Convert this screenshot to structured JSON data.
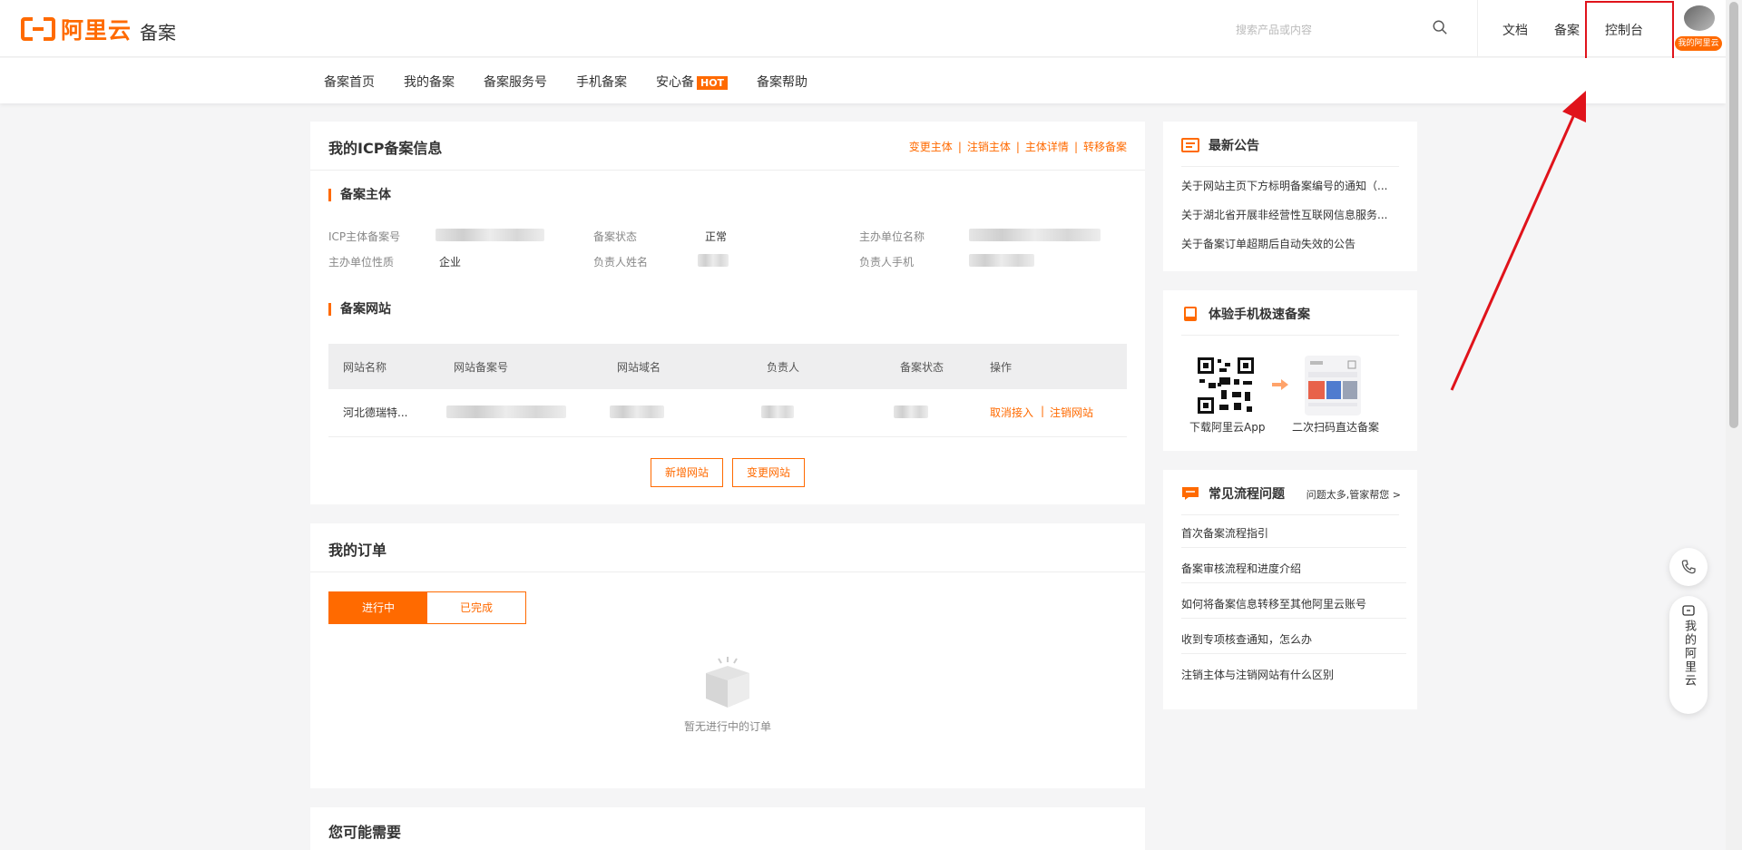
{
  "header": {
    "logo_text": "阿里云",
    "brand_sub": "备案",
    "search_placeholder": "搜索产品或内容",
    "links": [
      "文档",
      "备案",
      "控制台"
    ],
    "avatar_badge": "我的阿里云"
  },
  "subnav": {
    "items": [
      "备案首页",
      "我的备案",
      "备案服务号",
      "手机备案",
      "安心备",
      "备案帮助"
    ],
    "hot_badge": "HOT"
  },
  "icp_card": {
    "title": "我的ICP备案信息",
    "links": [
      "变更主体",
      "注销主体",
      "主体详情",
      "转移备案"
    ],
    "subject_section": "备案主体",
    "fields": {
      "icp_no_label": "ICP主体备案号",
      "status_label": "备案状态",
      "status_value": "正常",
      "org_name_label": "主办单位名称",
      "org_type_label": "主办单位性质",
      "org_type_value": "企业",
      "owner_name_label": "负责人姓名",
      "owner_phone_label": "负责人手机"
    },
    "website_section": "备案网站",
    "table": {
      "headers": [
        "网站名称",
        "网站备案号",
        "网站域名",
        "负责人",
        "备案状态",
        "操作"
      ],
      "rows": [
        {
          "site_name": "河北德瑞特...",
          "actions": [
            "取消接入",
            "注销网站"
          ]
        }
      ]
    },
    "buttons": [
      "新增网站",
      "变更网站"
    ]
  },
  "orders_card": {
    "title": "我的订单",
    "tabs": [
      "进行中",
      "已完成"
    ],
    "empty_text": "暂无进行中的订单"
  },
  "maybe_card": {
    "title": "您可能需要"
  },
  "notice_card": {
    "title": "最新公告",
    "items": [
      "关于网站主页下方标明备案编号的通知（...",
      "关于湖北省开展非经营性互联网信息服务...",
      "关于备案订单超期后自动失效的公告"
    ]
  },
  "mobile_card": {
    "title": "体验手机极速备案",
    "captions": [
      "下载阿里云App",
      "二次扫码直达备案"
    ]
  },
  "faq_card": {
    "title": "常见流程问题",
    "more": "问题太多,管家帮您",
    "items": [
      "首次备案流程指引",
      "备案审核流程和进度介绍",
      "如何将备案信息转移至其他阿里云账号",
      "收到专项核查通知，怎么办",
      "注销主体与注销网站有什么区别"
    ]
  },
  "float": {
    "my_aliyun": "我的阿里云"
  },
  "colors": {
    "accent": "#ff6a00",
    "highlight": "#e0131b"
  }
}
